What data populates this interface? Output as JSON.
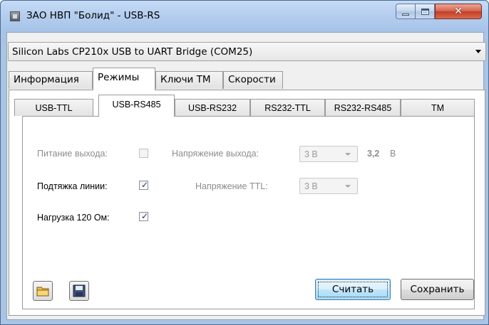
{
  "window": {
    "title": "ЗАО НВП \"Болид\" - USB-RS",
    "close_symbol": "✕"
  },
  "device": {
    "selected": "Silicon Labs CP210x USB to UART Bridge (COM25)"
  },
  "main_tabs": [
    {
      "label": "Информация",
      "active": false
    },
    {
      "label": "Режимы",
      "active": true
    },
    {
      "label": "Ключи ТМ",
      "active": false
    },
    {
      "label": "Скорости",
      "active": false
    }
  ],
  "mode_tabs": [
    {
      "label": "USB-TTL",
      "active": false
    },
    {
      "label": "USB-RS485",
      "active": true
    },
    {
      "label": "USB-RS232",
      "active": false
    },
    {
      "label": "RS232-TTL",
      "active": false
    },
    {
      "label": "RS232-RS485",
      "active": false
    },
    {
      "label": "TM",
      "active": false
    }
  ],
  "settings": {
    "power_output": {
      "label": "Питание выхода:",
      "checked": false,
      "enabled": false
    },
    "output_voltage": {
      "label": "Напряжение выхода:",
      "value": "3 В",
      "enabled": false
    },
    "measured_voltage": {
      "value": "3,2",
      "unit": "В"
    },
    "line_pullup": {
      "label": "Подтяжка линии:",
      "checked": true,
      "enabled": true
    },
    "ttl_voltage": {
      "label": "Напряжение TTL:",
      "value": "3 В",
      "enabled": false
    },
    "load_120": {
      "label": "Нагрузка 120 Ом:",
      "checked": true,
      "enabled": true
    }
  },
  "buttons": {
    "open_icon": "folder-open-icon",
    "save_icon": "floppy-disk-icon",
    "read": "Считать",
    "save": "Сохранить"
  },
  "colors": {
    "accent": "#3c7fb1",
    "disabled_text": "#8c8c8c",
    "titlebar": "#b3cdee"
  }
}
